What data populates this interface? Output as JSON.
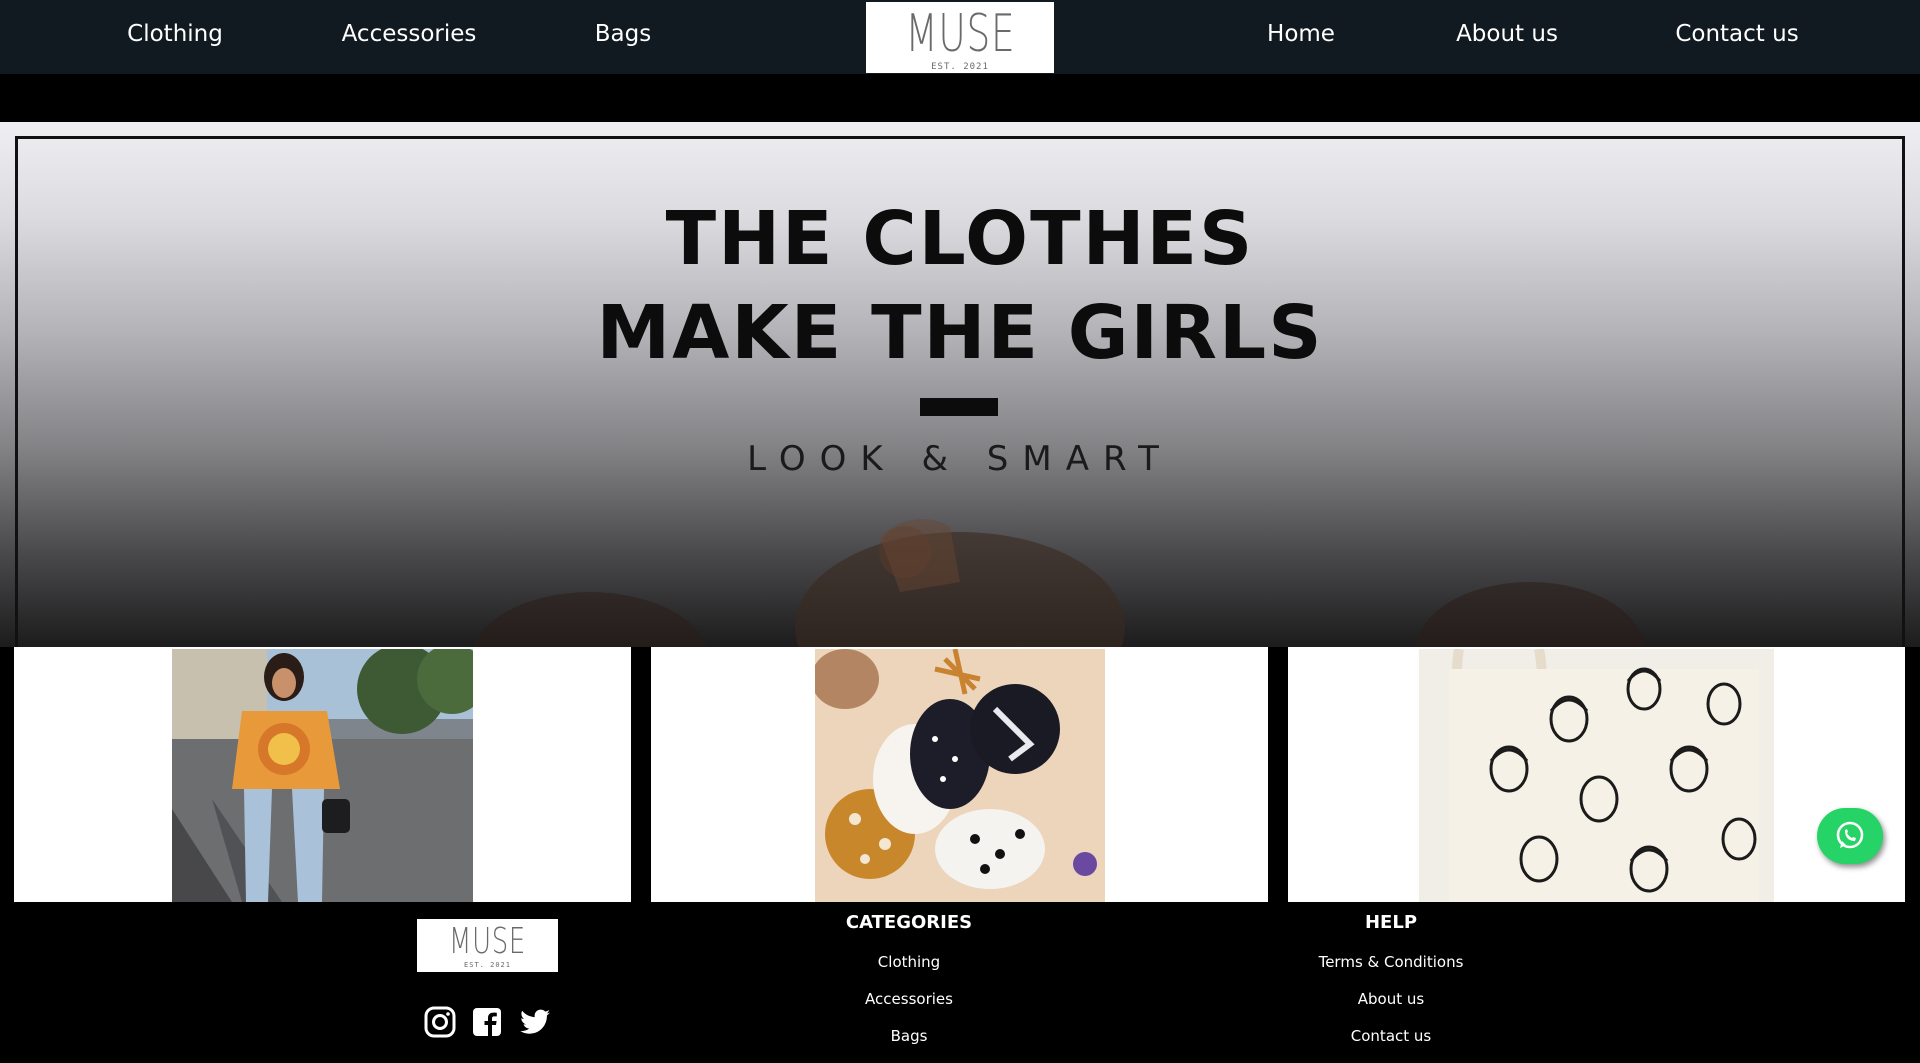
{
  "nav": {
    "left_links": [
      "Clothing",
      "Accessories",
      "Bags"
    ],
    "right_links": [
      "Home",
      "About us",
      "Contact us"
    ],
    "logo_text": "MUSE",
    "logo_subtext": "EST. 2021"
  },
  "hero": {
    "title_line1": "THE CLOTHES",
    "title_line2": "MAKE THE GIRLS",
    "subtitle": "LOOK & SMART"
  },
  "products": [
    {
      "category": "Clothing",
      "image": "woman in orange sun graphic tee and ripped jeans"
    },
    {
      "category": "Accessories",
      "image": "patterned face masks with dried flowers"
    },
    {
      "category": "Bags",
      "image": "canvas tote bag with illustrated faces"
    }
  ],
  "whatsapp": {
    "icon": "whatsapp-icon",
    "color": "#25d366"
  },
  "footer": {
    "logo_text": "MUSE",
    "logo_subtext": "EST. 2021",
    "social_icons": [
      "instagram-icon",
      "facebook-icon",
      "twitter-icon"
    ],
    "categories": {
      "heading": "CATEGORIES",
      "links": [
        "Clothing",
        "Accessories",
        "Bags"
      ]
    },
    "help": {
      "heading": "HELP",
      "links": [
        "Terms & Conditions",
        "About us",
        "Contact us"
      ]
    }
  },
  "colors": {
    "nav_bg": "#121a21",
    "page_bg": "#000000",
    "text": "#ffffff"
  }
}
